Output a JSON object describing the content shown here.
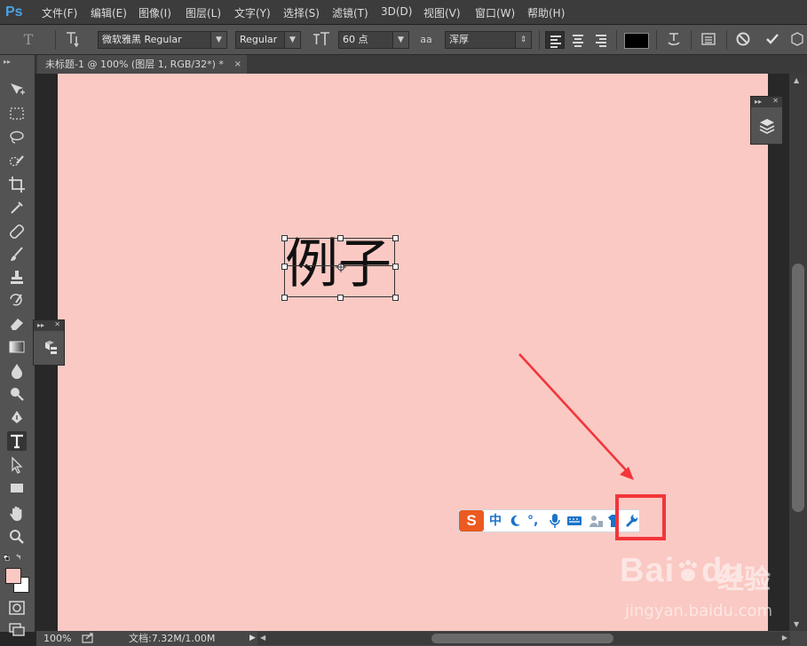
{
  "app": {
    "logo": "Ps"
  },
  "menu": [
    "文件(F)",
    "编辑(E)",
    "图像(I)",
    "图层(L)",
    "文字(Y)",
    "选择(S)",
    "滤镜(T)",
    "3D(D)",
    "视图(V)",
    "窗口(W)",
    "帮助(H)"
  ],
  "options": {
    "tool_icon": "T",
    "font_family": "微软雅黑 Regular",
    "font_style": "Regular",
    "font_size": "60 点",
    "aa_label": "aa",
    "antialias": "浑厚",
    "text_color": "#000000"
  },
  "document": {
    "tab_title": "未标题-1 @ 100% (图层 1, RGB/32*) *",
    "close": "×",
    "canvas_color": "#fac9c3",
    "text": "例子"
  },
  "ime": {
    "logo": "S",
    "mode": "中",
    "punct": "°,",
    "highlight_color": "#f2353b"
  },
  "status": {
    "zoom": "100%",
    "doc_info": "文档:7.32M/1.00M"
  },
  "watermark": {
    "logo": "Bai",
    "brand": "du",
    "cn": "经验",
    "url": "jingyan.baidu.com"
  }
}
